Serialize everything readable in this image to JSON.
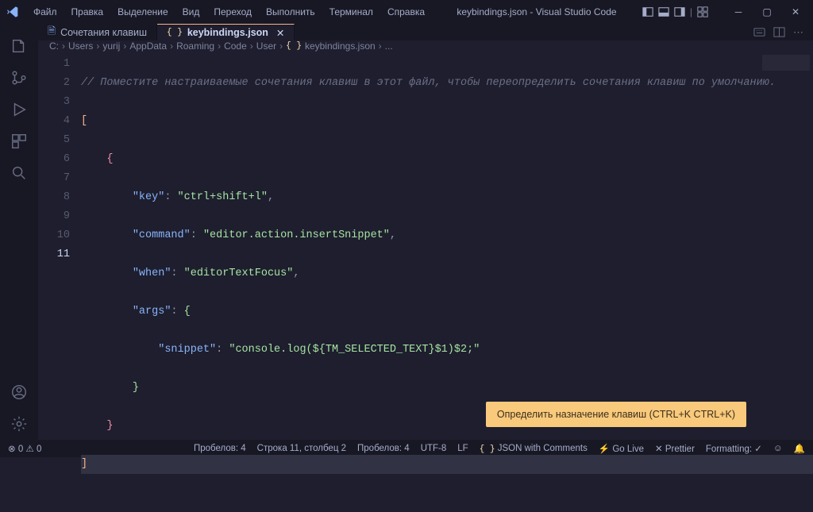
{
  "menu": {
    "file": "Файл",
    "edit": "Правка",
    "selection": "Выделение",
    "view": "Вид",
    "go": "Переход",
    "run": "Выполнить",
    "terminal": "Терминал",
    "help": "Справка"
  },
  "window_title": "keybindings.json - Visual Studio Code",
  "tabs": {
    "t0": {
      "label": "Сочетания клавиш"
    },
    "t1": {
      "label": "keybindings.json"
    }
  },
  "breadcrumb": {
    "p0": "C:",
    "p1": "Users",
    "p2": "yurij",
    "p3": "AppData",
    "p4": "Roaming",
    "p5": "Code",
    "p6": "User",
    "p7": "keybindings.json",
    "p8": "..."
  },
  "lines": {
    "l1": "1",
    "l2": "2",
    "l3": "3",
    "l4": "4",
    "l5": "5",
    "l6": "6",
    "l7": "7",
    "l8": "8",
    "l9": "9",
    "l10": "10",
    "l11": "11"
  },
  "code": {
    "comment": "// Поместите настраиваемые сочетания клавиш в этот файл, чтобы переопределить сочетания клавиш по умолчанию.",
    "k_key": "\"key\"",
    "v_key": "\"ctrl+shift+l\"",
    "k_command": "\"command\"",
    "v_command": "\"editor.action.insertSnippet\"",
    "k_when": "\"when\"",
    "v_when": "\"editorTextFocus\"",
    "k_args": "\"args\"",
    "k_snippet": "\"snippet\"",
    "v_snippet": "\"console.log(${TM_SELECTED_TEXT}$1)$2;\""
  },
  "status": {
    "errors": "0",
    "warnings": "0",
    "spaces": "Пробелов: 4",
    "line_col": "Строка 11, столбец 2",
    "indent": "Пробелов: 4",
    "encoding": "UTF-8",
    "eol": "LF",
    "lang": "JSON with Comments",
    "golive": "Go Live",
    "prettier": "Prettier",
    "formatting": "Formatting:"
  },
  "toast": "Определить назначение клавиш (CTRL+K CTRL+K)"
}
